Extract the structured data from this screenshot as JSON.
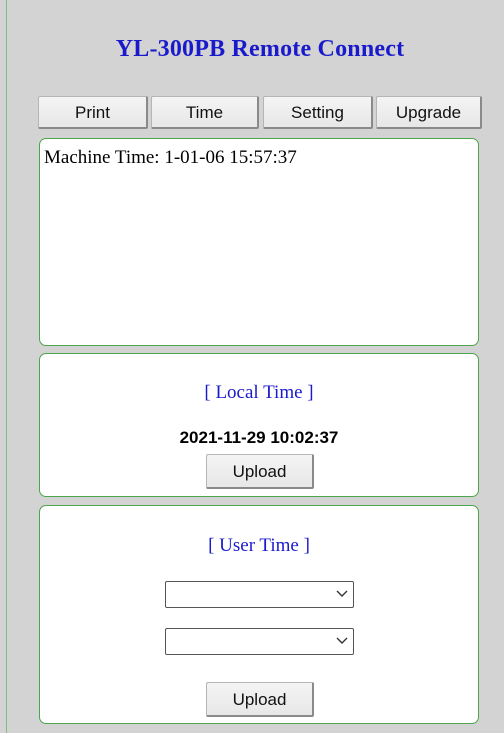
{
  "header": {
    "title": "YL-300PB Remote Connect"
  },
  "toolbar": {
    "print_label": "Print",
    "time_label": "Time",
    "setting_label": "Setting",
    "upgrade_label": "Upgrade"
  },
  "log": {
    "text": "Machine Time: 1-01-06 15:57:37"
  },
  "local_time": {
    "title": "[ Local Time ]",
    "value": "2021-11-29 10:02:37",
    "upload_label": "Upload"
  },
  "user_time": {
    "title": "[ User Time ]",
    "select1_value": "",
    "select2_value": "",
    "upload_label": "Upload"
  },
  "colors": {
    "title_blue": "#1a1acc",
    "panel_border_green": "#4ca64c",
    "page_background": "#d3d3d3"
  },
  "icons": [
    "chevron-down-icon"
  ]
}
